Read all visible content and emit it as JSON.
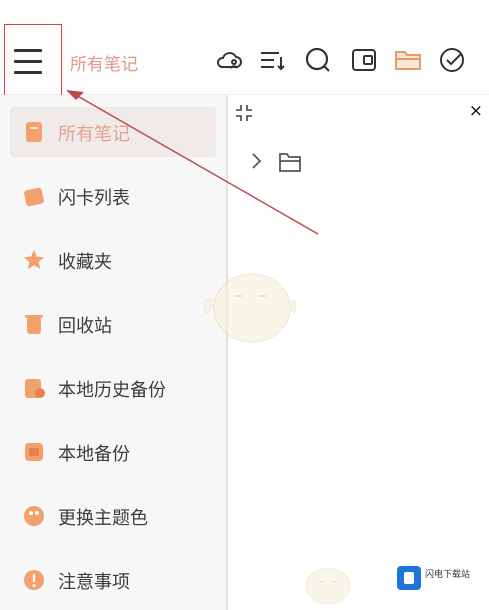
{
  "header": {
    "title": "所有笔记",
    "icons": [
      "cloud-user-icon",
      "sort-list-icon",
      "search-icon",
      "wallet-icon",
      "folder-icon",
      "check-circle-icon"
    ]
  },
  "sidebar": {
    "items": [
      {
        "label": "所有笔记",
        "icon": "note-icon",
        "active": true
      },
      {
        "label": "闪卡列表",
        "icon": "flashcard-icon",
        "active": false
      },
      {
        "label": "收藏夹",
        "icon": "star-icon",
        "active": false
      },
      {
        "label": "回收站",
        "icon": "trash-icon",
        "active": false
      },
      {
        "label": "本地历史备份",
        "icon": "history-backup-icon",
        "active": false
      },
      {
        "label": "本地备份",
        "icon": "backup-icon",
        "active": false
      },
      {
        "label": "更换主题色",
        "icon": "palette-icon",
        "active": false
      },
      {
        "label": "注意事项",
        "icon": "info-icon",
        "active": false
      }
    ]
  },
  "panel": {
    "close_label": "×"
  },
  "watermark": {
    "text": "闪电下载站"
  },
  "colors": {
    "accent": "#e5a08f",
    "icon_orange": "#f0a070",
    "highlight_border": "#c9474a"
  }
}
